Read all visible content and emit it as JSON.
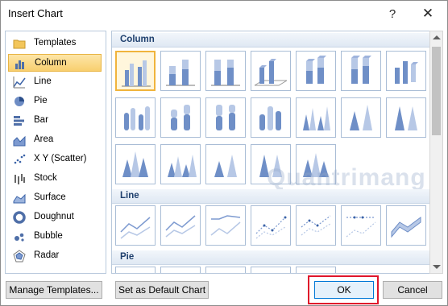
{
  "window": {
    "title": "Insert Chart",
    "help_icon": "?",
    "close_icon": "✕"
  },
  "chart_types": [
    {
      "label": "Templates",
      "icon": "folder-icon"
    },
    {
      "label": "Column",
      "icon": "column-chart-icon",
      "selected": true
    },
    {
      "label": "Line",
      "icon": "line-chart-icon"
    },
    {
      "label": "Pie",
      "icon": "pie-chart-icon"
    },
    {
      "label": "Bar",
      "icon": "bar-chart-icon"
    },
    {
      "label": "Area",
      "icon": "area-chart-icon"
    },
    {
      "label": "X Y (Scatter)",
      "icon": "scatter-chart-icon"
    },
    {
      "label": "Stock",
      "icon": "stock-chart-icon"
    },
    {
      "label": "Surface",
      "icon": "surface-chart-icon"
    },
    {
      "label": "Doughnut",
      "icon": "doughnut-chart-icon"
    },
    {
      "label": "Bubble",
      "icon": "bubble-chart-icon"
    },
    {
      "label": "Radar",
      "icon": "radar-chart-icon"
    }
  ],
  "sections": [
    {
      "title": "Column",
      "subtypes": 19,
      "selected_index": 0
    },
    {
      "title": "Line",
      "subtypes": 7
    },
    {
      "title": "Pie",
      "subtypes": 5
    }
  ],
  "watermark": "Quantrimang",
  "buttons": {
    "manage_templates": "Manage Templates...",
    "set_default": "Set as Default Chart",
    "ok": "OK",
    "cancel": "Cancel"
  },
  "colors": {
    "accent": "#f0b43c",
    "highlight_frame": "#e0162b",
    "section_text": "#1e3f6d"
  }
}
